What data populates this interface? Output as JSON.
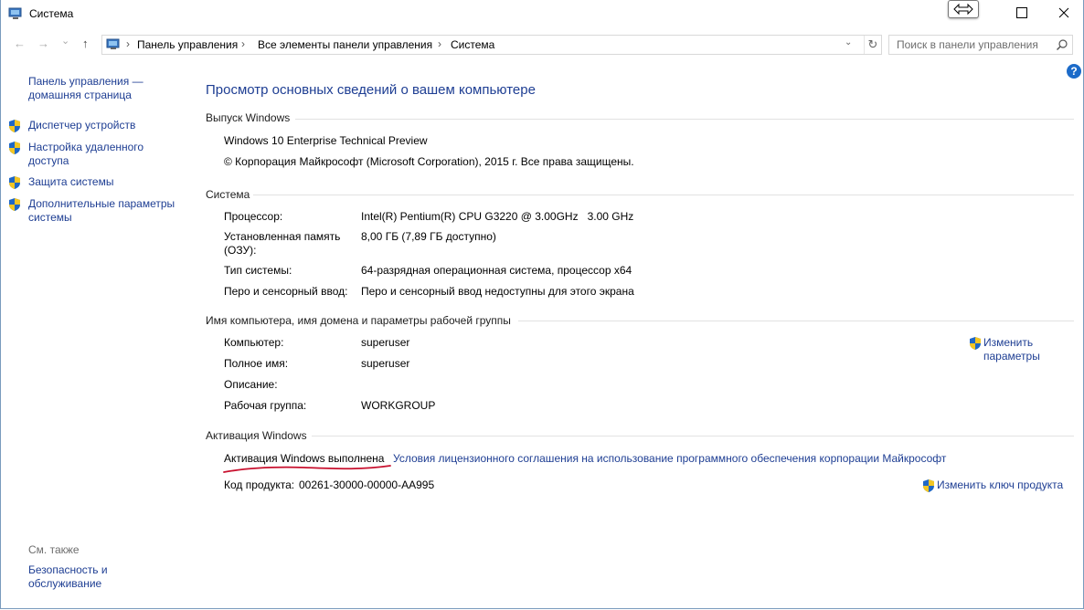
{
  "window": {
    "title": "Система",
    "minimize": "—",
    "maximize": "□",
    "close": "✕"
  },
  "nav": {
    "back": "←",
    "forward": "→",
    "recent": "⌄",
    "up": "↑",
    "breadcrumbs": [
      "Панель управления",
      "Все элементы панели управления",
      "Система"
    ],
    "refresh": "↻",
    "dropdown": "⌄",
    "search_placeholder": "Поиск в панели управления"
  },
  "help": "?",
  "sidebar": {
    "home_line1": "Панель управления —",
    "home_line2": "домашняя страница",
    "items": [
      {
        "label_line1": "Диспетчер устройств",
        "label_line2": ""
      },
      {
        "label_line1": "Настройка удаленного",
        "label_line2": "доступа"
      },
      {
        "label_line1": "Защита системы",
        "label_line2": ""
      },
      {
        "label_line1": "Дополнительные параметры",
        "label_line2": "системы"
      }
    ],
    "see_also": "См. также",
    "security_line1": "Безопасность и",
    "security_line2": "обслуживание"
  },
  "main": {
    "title": "Просмотр основных сведений о вашем компьютере",
    "edition": {
      "header": "Выпуск Windows",
      "name": "Windows 10 Enterprise Technical Preview",
      "copyright": "© Корпорация Майкрософт (Microsoft Corporation), 2015 г. Все права защищены."
    },
    "system": {
      "header": "Система",
      "rows": [
        {
          "label": "Процессор:",
          "value": "Intel(R) Pentium(R) CPU G3220 @ 3.00GHz   3.00 GHz"
        },
        {
          "label": "Установленная память (ОЗУ):",
          "value": "8,00 ГБ (7,89 ГБ доступно)"
        },
        {
          "label": "Тип системы:",
          "value": "64-разрядная операционная система, процессор x64"
        },
        {
          "label": "Перо и сенсорный ввод:",
          "value": "Перо и сенсорный ввод недоступны для этого экрана"
        }
      ],
      "ram_label_line1": "Установленная память",
      "ram_label_line2": "(ОЗУ):"
    },
    "computer": {
      "header": "Имя компьютера, имя домена и параметры рабочей группы",
      "rows": [
        {
          "label": "Компьютер:",
          "value": "superuser"
        },
        {
          "label": "Полное имя:",
          "value": "superuser"
        },
        {
          "label": "Описание:",
          "value": ""
        },
        {
          "label": "Рабочая группа:",
          "value": "WORKGROUP"
        }
      ],
      "change_line1": "Изменить",
      "change_line2": "параметры"
    },
    "activation": {
      "header": "Активация Windows",
      "status": "Активация Windows выполнена",
      "license_link": "Условия лицензионного соглашения на использование программного обеспечения корпорации Майкрософт",
      "product_key_label": "Код продукта:",
      "product_key": "00261-30000-00000-AA995",
      "change_key": "Изменить ключ продукта"
    }
  },
  "colors": {
    "link": "#1e3e93",
    "annotation": "#c8102e"
  }
}
